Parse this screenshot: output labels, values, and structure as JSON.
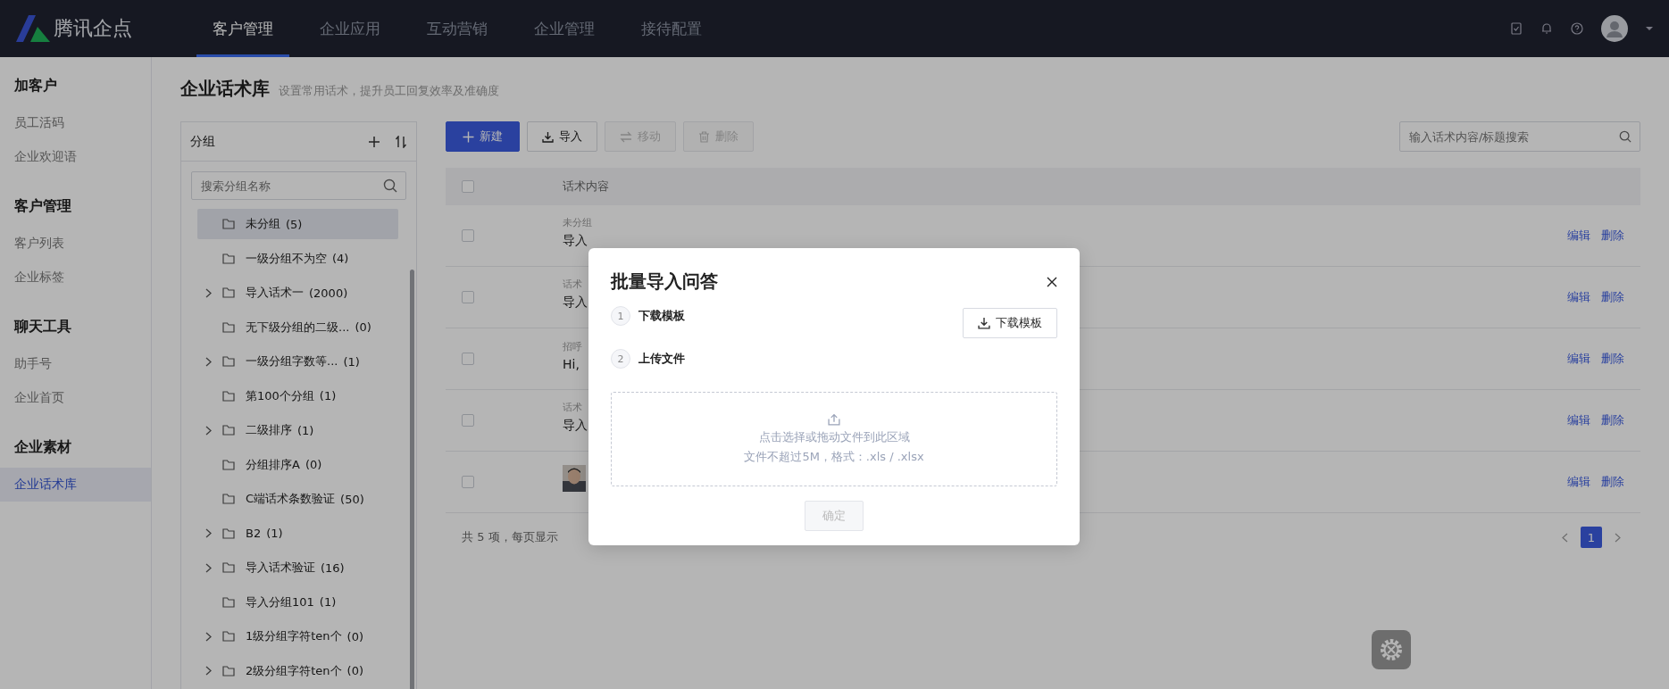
{
  "topbar": {
    "logo": "腾讯企点",
    "nav": [
      {
        "label": "客户管理",
        "selected": true
      },
      {
        "label": "企业应用",
        "selected": false
      },
      {
        "label": "互动营销",
        "selected": false
      },
      {
        "label": "企业管理",
        "selected": false
      },
      {
        "label": "接待配置",
        "selected": false
      }
    ]
  },
  "sidebar": {
    "sections": [
      {
        "title": "加客户",
        "items": [
          {
            "label": "员工活码",
            "selected": false
          },
          {
            "label": "企业欢迎语",
            "selected": false
          }
        ]
      },
      {
        "title": "客户管理",
        "items": [
          {
            "label": "客户列表",
            "selected": false
          },
          {
            "label": "企业标签",
            "selected": false
          }
        ]
      },
      {
        "title": "聊天工具",
        "items": [
          {
            "label": "助手号",
            "selected": false
          },
          {
            "label": "企业首页",
            "selected": false
          }
        ]
      },
      {
        "title": "企业素材",
        "items": [
          {
            "label": "企业话术库",
            "selected": true
          }
        ]
      }
    ]
  },
  "page": {
    "title": "企业话术库",
    "subtitle": "设置常用话术，提升员工回复效率及准确度"
  },
  "groups": {
    "title": "分组",
    "search": {
      "placeholder": "搜索分组名称"
    },
    "items": [
      {
        "label": "未分组",
        "count": "(5)",
        "has_children": false,
        "selected": true
      },
      {
        "label": "一级分组不为空",
        "count": "(4)",
        "has_children": false,
        "selected": false
      },
      {
        "label": "导入话术一",
        "count": "(2000)",
        "has_children": true,
        "selected": false
      },
      {
        "label": "无下级分组的二级...",
        "count": "(0)",
        "has_children": false,
        "selected": false
      },
      {
        "label": "一级分组字数等...",
        "count": "(1)",
        "has_children": true,
        "selected": false
      },
      {
        "label": "第100个分组",
        "count": "(1)",
        "has_children": false,
        "selected": false
      },
      {
        "label": "二级排序",
        "count": "(1)",
        "has_children": true,
        "selected": false
      },
      {
        "label": "分组排序A",
        "count": "(0)",
        "has_children": false,
        "selected": false
      },
      {
        "label": "C端话术条数验证",
        "count": "(50)",
        "has_children": false,
        "selected": false
      },
      {
        "label": "B2",
        "count": "(1)",
        "has_children": true,
        "selected": false
      },
      {
        "label": "导入话术验证",
        "count": "(16)",
        "has_children": true,
        "selected": false
      },
      {
        "label": "导入分组101",
        "count": "(1)",
        "has_children": false,
        "selected": false
      },
      {
        "label": "1级分组字符ten个",
        "count": "(0)",
        "has_children": true,
        "selected": false
      },
      {
        "label": "2级分组字符ten个",
        "count": "(0)",
        "has_children": true,
        "selected": false
      }
    ]
  },
  "toolbar": {
    "buttons": [
      {
        "label": "新建",
        "kind": "new",
        "disabled": false
      },
      {
        "label": "导入",
        "kind": "import",
        "disabled": false
      },
      {
        "label": "移动",
        "kind": "move",
        "disabled": true
      },
      {
        "label": "删除",
        "kind": "delete",
        "disabled": true
      }
    ],
    "search": {
      "placeholder": "输入话术内容/标题搜索"
    }
  },
  "table": {
    "all_checked": false,
    "columns": [
      "话术内容"
    ],
    "rows": [
      {
        "kind": "text",
        "checked": false,
        "group": "未分组",
        "content": "导入",
        "actions": [
          "编辑",
          "删除"
        ]
      },
      {
        "kind": "text",
        "checked": false,
        "group": "话术",
        "content": "导入",
        "actions": [
          "编辑",
          "删除"
        ]
      },
      {
        "kind": "text",
        "checked": false,
        "group": "招呼",
        "content": "Hi,",
        "actions": [
          "编辑",
          "删除"
        ]
      },
      {
        "kind": "text",
        "checked": false,
        "group": "话术",
        "content": "导入",
        "actions": [
          "编辑",
          "删除"
        ]
      },
      {
        "kind": "picture",
        "checked": false,
        "actions": [
          "编辑",
          "删除"
        ]
      }
    ]
  },
  "pagination": {
    "summary": "共 5 项，每页显示",
    "pages": [
      {
        "label": "1",
        "selected": true
      }
    ]
  },
  "dialog": {
    "title": "批量导入问答",
    "steps": [
      {
        "number": "1",
        "label": "下载模板"
      },
      {
        "number": "2",
        "label": "上传文件"
      }
    ],
    "download_button": "下载模板",
    "upload": {
      "hint": "点击选择或拖动文件到此区域",
      "note": "文件不超过5M，格式：.xls / .xlsx"
    },
    "confirm": {
      "label": "确定",
      "disabled": true
    }
  }
}
